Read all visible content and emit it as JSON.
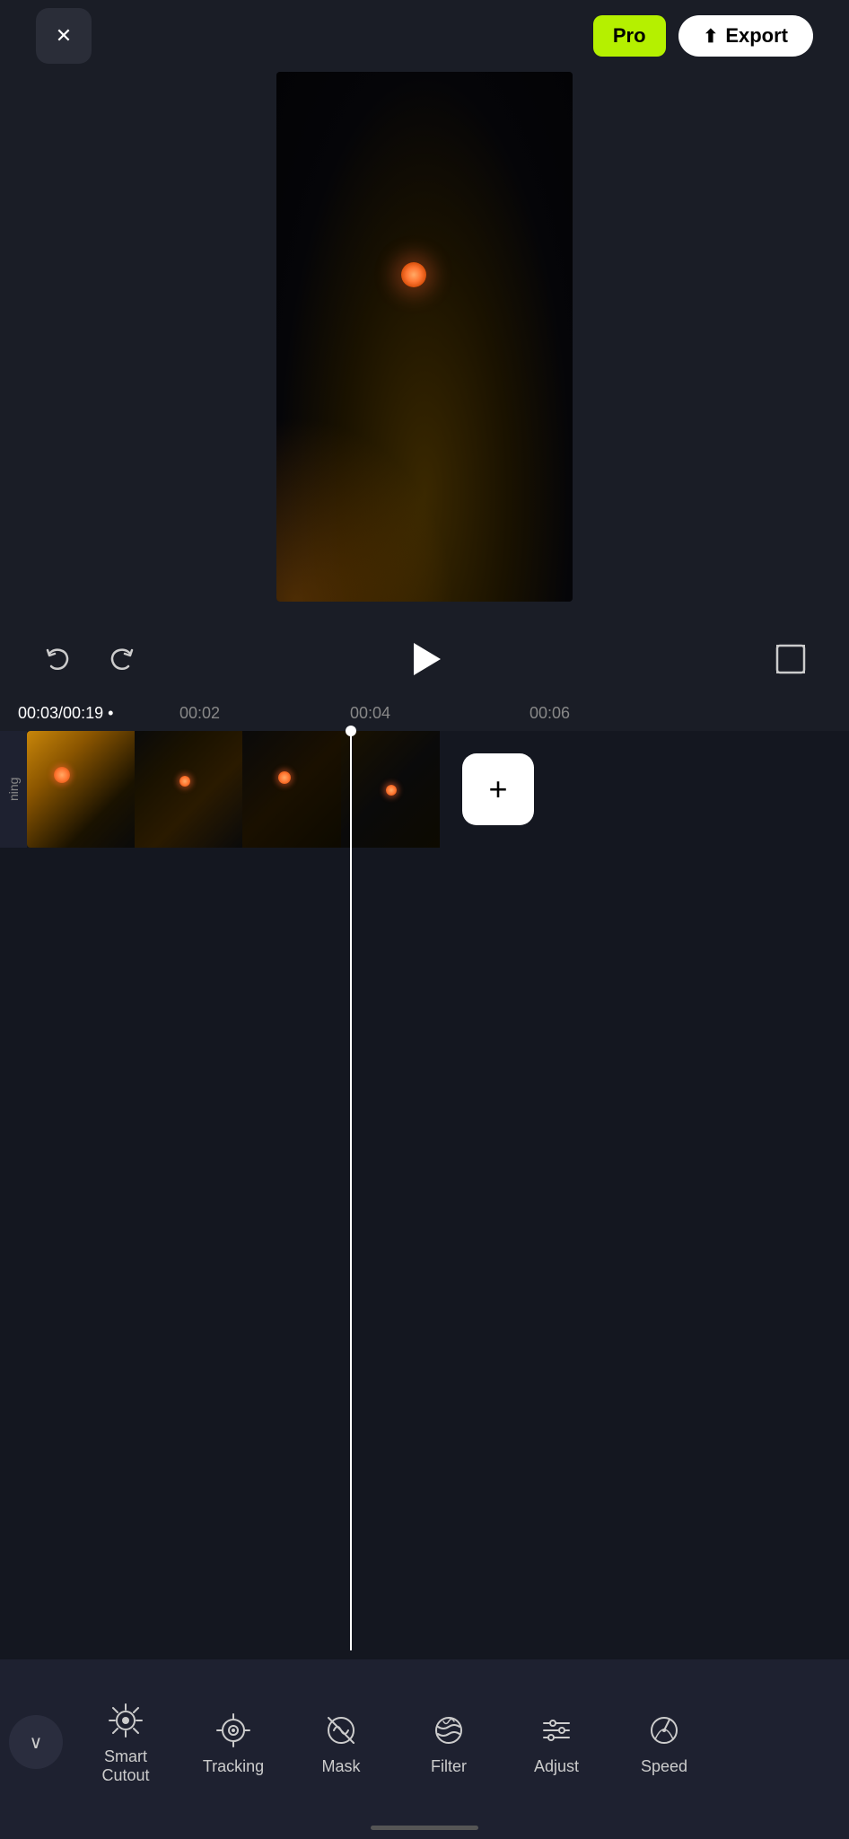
{
  "header": {
    "close_label": "×",
    "pro_label": "Pro",
    "export_label": "Export",
    "export_icon": "↑"
  },
  "playback": {
    "current_time": "00:03",
    "total_time": "00:19",
    "undo_icon": "↩",
    "redo_icon": "↪"
  },
  "timeline": {
    "ruler_times": [
      "00:03/00:19 •",
      "00:02",
      "00:04",
      "00:06"
    ],
    "ruler_positions": [
      20,
      200,
      400,
      600
    ],
    "track_label": "ning"
  },
  "tools": [
    {
      "id": "smart-cutout",
      "label": "Smart\nCutout",
      "icon": "smart_cutout"
    },
    {
      "id": "tracking",
      "label": "Tracking",
      "icon": "tracking"
    },
    {
      "id": "mask",
      "label": "Mask",
      "icon": "mask"
    },
    {
      "id": "filter",
      "label": "Filter",
      "icon": "filter"
    },
    {
      "id": "adjust",
      "label": "Adjust",
      "icon": "adjust"
    },
    {
      "id": "speed",
      "label": "Speed",
      "icon": "speed"
    }
  ],
  "colors": {
    "background": "#1a1d26",
    "toolbar_bg": "#1e2130",
    "pro_green": "#b5f000",
    "white": "#ffffff",
    "accent": "#cccccc"
  }
}
